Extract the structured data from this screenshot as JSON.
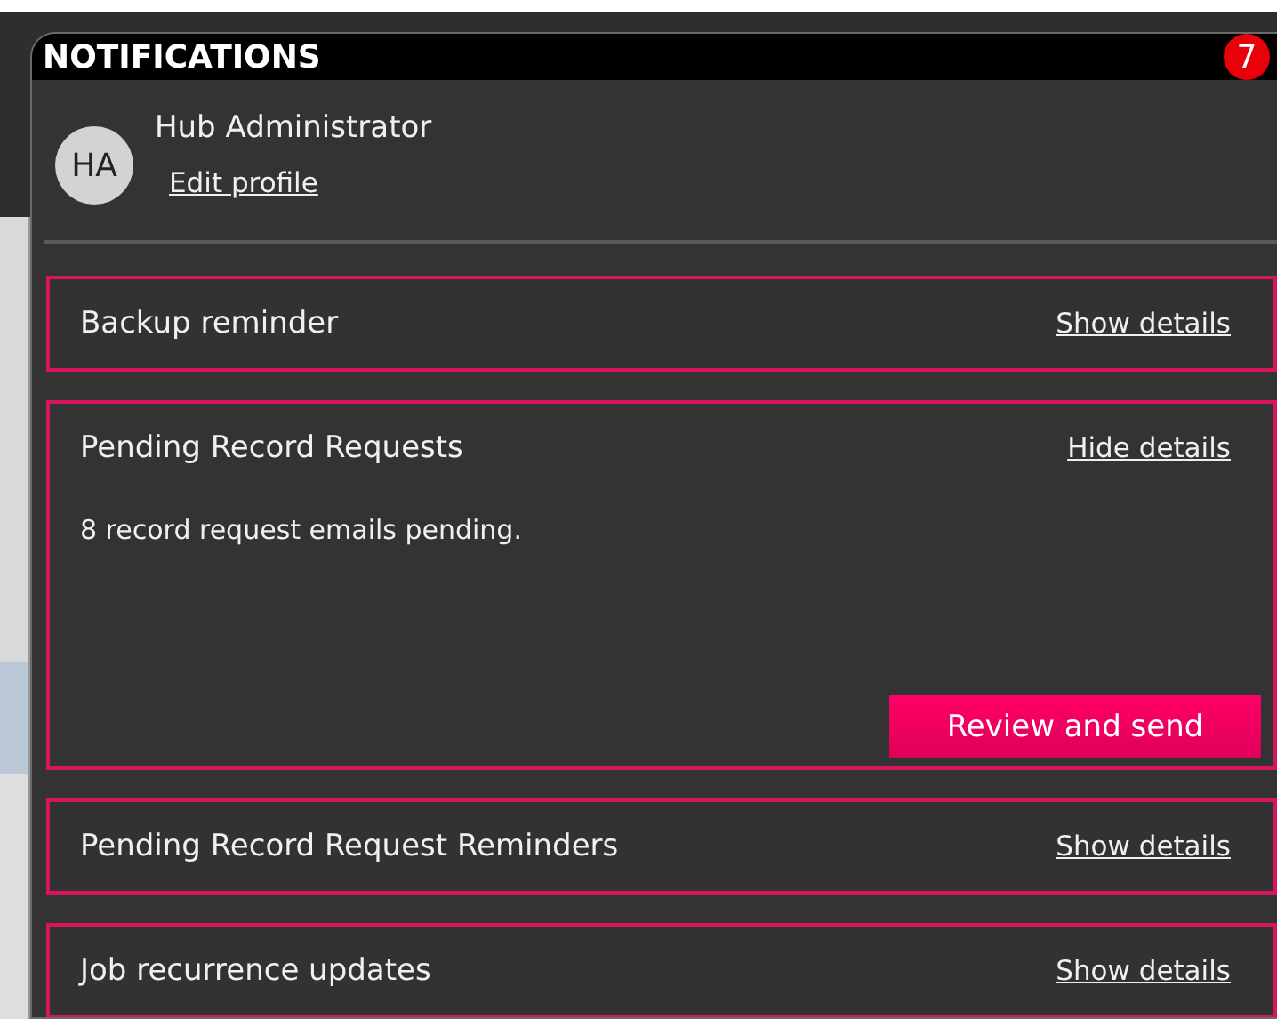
{
  "panel": {
    "title": "NOTIFICATIONS",
    "badge": "7"
  },
  "profile": {
    "initials": "HA",
    "name": "Hub Administrator",
    "edit_link": "Edit profile"
  },
  "notifications": [
    {
      "title": "Backup reminder",
      "toggle": "Show details",
      "expanded": false
    },
    {
      "title": "Pending Record Requests",
      "toggle": "Hide details",
      "expanded": true,
      "details": "8 record request emails pending.",
      "action": "Review and send"
    },
    {
      "title": "Pending Record Request Reminders",
      "toggle": "Show details",
      "expanded": false
    },
    {
      "title": "Job recurrence updates",
      "toggle": "Show details",
      "expanded": false
    }
  ]
}
